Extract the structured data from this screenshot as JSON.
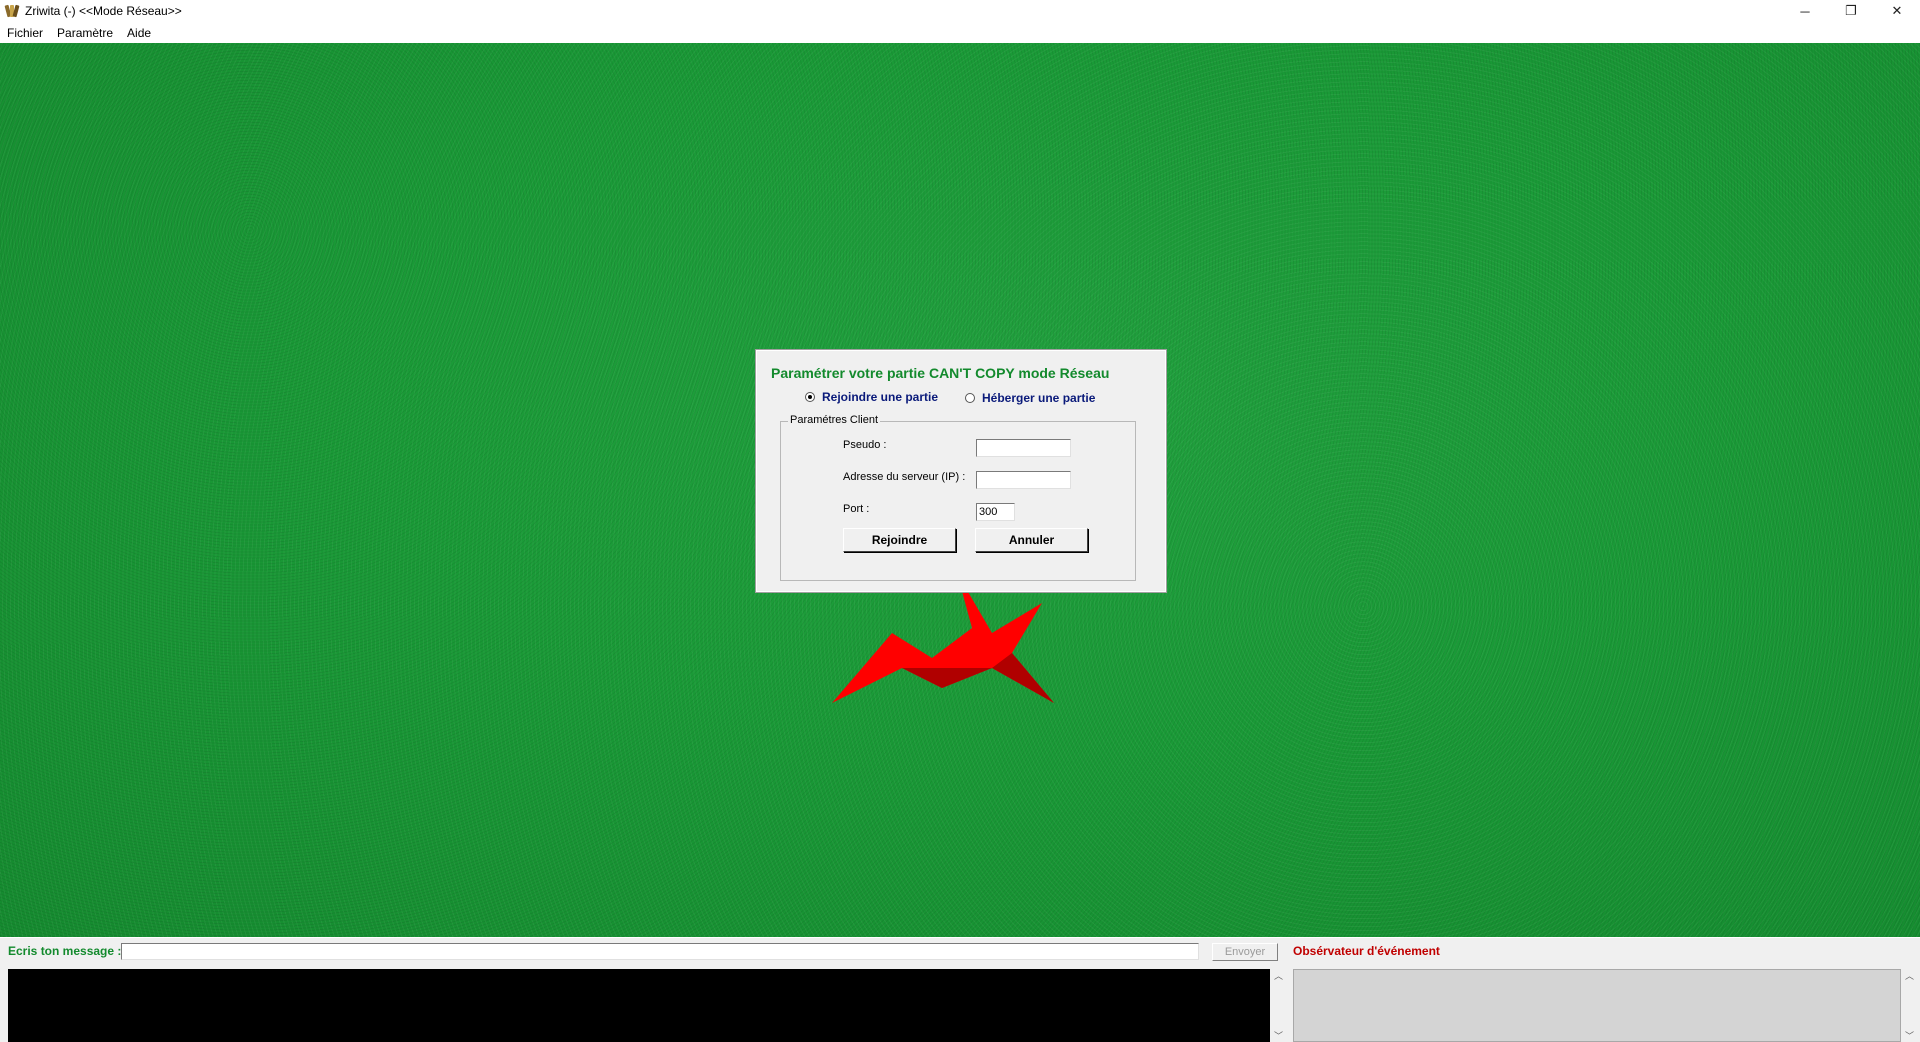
{
  "window": {
    "title": "Zriwita (-)  <<Mode Réseau>>",
    "controls": {
      "minimize": "─",
      "restore": "❐",
      "close": "✕"
    }
  },
  "menu": [
    "Fichier",
    "Paramètre",
    "Aide"
  ],
  "dialog": {
    "title": "Paramétrer votre partie CAN'T COPY mode Réseau",
    "radio_join": "Rejoindre une partie",
    "radio_host": "Héberger une partie",
    "selected": "join",
    "group_title": "Paramétres Client",
    "pseudo_label": "Pseudo   :",
    "pseudo_value": "",
    "server_label": "Adresse du serveur (IP) :",
    "server_value": "",
    "port_label": "Port :",
    "port_value": "300",
    "join_button": "Rejoindre",
    "cancel_button": "Annuler"
  },
  "chat": {
    "label": "Ecris ton message :",
    "input_value": "",
    "send_button": "Envoyer",
    "send_enabled": false
  },
  "events": {
    "label": "Obsérvateur d'événement"
  },
  "colors": {
    "felt": "#1a9a37",
    "dialog_title": "#138a2d",
    "radio_label": "#0a1a7a",
    "events_label": "#c00000",
    "logo_star": "#ff0000"
  }
}
